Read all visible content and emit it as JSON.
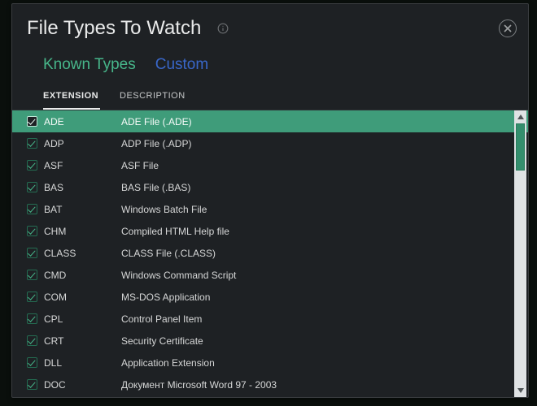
{
  "title": "File Types To Watch",
  "tabs": {
    "known": "Known Types",
    "custom": "Custom"
  },
  "columns": {
    "ext": "EXTENSION",
    "desc": "DESCRIPTION"
  },
  "rows": [
    {
      "ext": "ADE",
      "desc": "ADE File (.ADE)",
      "selected": true
    },
    {
      "ext": "ADP",
      "desc": "ADP File (.ADP)",
      "selected": false
    },
    {
      "ext": "ASF",
      "desc": "ASF File",
      "selected": false
    },
    {
      "ext": "BAS",
      "desc": "BAS File (.BAS)",
      "selected": false
    },
    {
      "ext": "BAT",
      "desc": "Windows Batch File",
      "selected": false
    },
    {
      "ext": "CHM",
      "desc": "Compiled HTML Help file",
      "selected": false
    },
    {
      "ext": "CLASS",
      "desc": "CLASS File (.CLASS)",
      "selected": false
    },
    {
      "ext": "CMD",
      "desc": "Windows Command Script",
      "selected": false
    },
    {
      "ext": "COM",
      "desc": "MS-DOS Application",
      "selected": false
    },
    {
      "ext": "CPL",
      "desc": "Control Panel Item",
      "selected": false
    },
    {
      "ext": "CRT",
      "desc": "Security Certificate",
      "selected": false
    },
    {
      "ext": "DLL",
      "desc": "Application Extension",
      "selected": false
    },
    {
      "ext": "DOC",
      "desc": "Документ Microsoft Word 97 - 2003",
      "selected": false
    }
  ],
  "colors": {
    "accent": "#47b68a",
    "link": "#3967c9",
    "bg": "#1e2124"
  }
}
